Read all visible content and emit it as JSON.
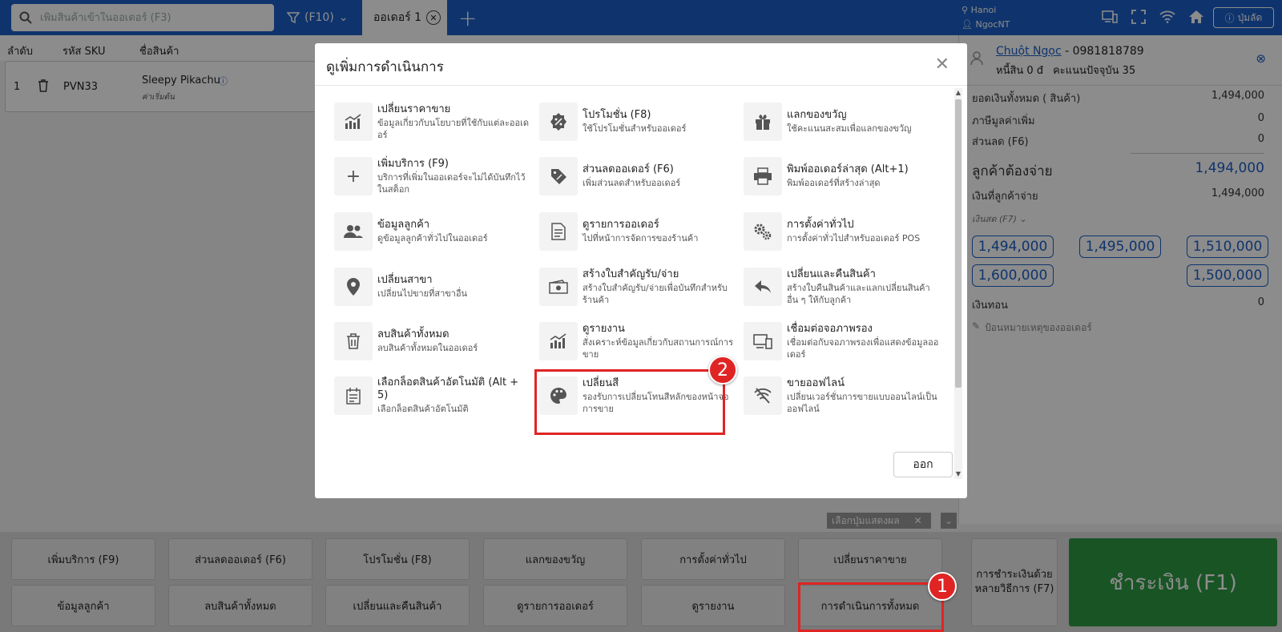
{
  "topbar": {
    "search_placeholder": "เพิ่มสินค้าเข้าในออเดอร์ (F3)",
    "f10_label": "(F10)",
    "active_tab": "ออเดอร์ 1",
    "location": "Hanoi",
    "user": "NgocNT",
    "shortcut_button": "ปุ่มลัด"
  },
  "table": {
    "headers": [
      "ลำดับ",
      "รหัส SKU",
      "ชื่อสินค้า"
    ],
    "row": {
      "index": "1",
      "sku": "PVN33",
      "name": "Sleepy Pikachu",
      "note": "ค่าเริ่มต้น"
    }
  },
  "customer": {
    "name": "Chuột Ngọc",
    "phone": " - 0981818789",
    "debt": "หนี้สิน 0 đ",
    "points": "คะแนนปัจจุบัน 35"
  },
  "summary": {
    "total_label": "ยอดเงินทั้งหมด ( สินค้า)",
    "total_value": "1,494,000",
    "vat_label": "ภาษีมูลค่าเพิ่ม",
    "vat_value": "0",
    "discount_label": "ส่วนลด (F6)",
    "discount_value": "0",
    "due_label": "ลูกค้าต้องจ่าย",
    "due_value": "1,494,000",
    "paid_label": "เงินที่ลูกค้าจ่าย",
    "paid_value": "1,494,000",
    "method_label": "เงินสด (F7)",
    "cash_buttons": [
      "1,494,000",
      "1,495,000",
      "1,510,000",
      "1,600,000",
      "1,500,000"
    ],
    "change_label": "เงินทอน",
    "change_value": "0",
    "note_placeholder": "ป้อนหมายเหตุของออเดอร์"
  },
  "modal": {
    "title": "ดูเพิ่มการดำเนินการ",
    "exit_label": "ออก",
    "actions": [
      {
        "title": "เปลี่ยนราคาขาย",
        "desc": "ข้อมูลเกี่ยวกับนโยบายที่ใช้กับแต่ละออเดอร์",
        "icon": "chart-icon"
      },
      {
        "title": "โปรโมชั่น (F8)",
        "desc": "ใช้โปรโมชั่นสำหรับออเดอร์",
        "icon": "promo-icon"
      },
      {
        "title": "แลกของขวัญ",
        "desc": "ใช้คะแนนสะสมเพื่อแลกของขวัญ",
        "icon": "gift-icon"
      },
      {
        "title": "เพิ่มบริการ (F9)",
        "desc": "บริการที่เพิ่มในออเดอร์จะไม่ได้บันทึกไว้ในสต็อก",
        "icon": "plus-icon"
      },
      {
        "title": "ส่วนลดออเดอร์ (F6)",
        "desc": "เพิ่มส่วนลดสำหรับออเดอร์",
        "icon": "discount-tag-icon"
      },
      {
        "title": "พิมพ์ออเดอร์ล่าสุด (Alt+1)",
        "desc": "พิมพ์ออเดอร์ที่สร้างล่าสุด",
        "icon": "printer-icon"
      },
      {
        "title": "ข้อมูลลูกค้า",
        "desc": "ดูข้อมูลลูกค้าทั่วไปในออเดอร์",
        "icon": "users-icon"
      },
      {
        "title": "ดูรายการออเดอร์",
        "desc": "ไปที่หน้าการจัดการของร้านค้า",
        "icon": "document-icon"
      },
      {
        "title": "การตั้งค่าทั่วไป",
        "desc": "การตั้งค่าทั่วไปสำหรับออเดอร์ POS",
        "icon": "gears-icon"
      },
      {
        "title": "เปลี่ยนสาขา",
        "desc": "เปลี่ยนไปขายที่สาขาอื่น",
        "icon": "location-pin-icon"
      },
      {
        "title": "สร้างใบสำคัญรับ/จ่าย",
        "desc": "สร้างใบสำคัญรับ/จ่ายเพื่อบันทึกสำหรับร้านค้า",
        "icon": "cash-icon"
      },
      {
        "title": "เปลี่ยนและคืนสินค้า",
        "desc": "สร้างใบคืนสินค้าและแลกเปลี่ยนสินค้าอื่น ๆ ให้กับลูกค้า",
        "icon": "reply-icon"
      },
      {
        "title": "ลบสินค้าทั้งหมด",
        "desc": "ลบสินค้าทั้งหมดในออเดอร์",
        "icon": "trash-icon"
      },
      {
        "title": "ดูรายงาน",
        "desc": "สั่งเคราะห์ข้อมูลเกี่ยวกับสถานการณ์การขาย",
        "icon": "report-chart-icon"
      },
      {
        "title": "เชื่อมต่อจอภาพรอง",
        "desc": "เชื่อมต่อกับจอภาพรองเพื่อแสดงข้อมูลออเดอร์",
        "icon": "devices-icon"
      },
      {
        "title": "เลือกล็อตสินค้าอัตโนมัติ (Alt + 5)",
        "desc": "เลือกล็อตสินค้าอัตโนมัติ",
        "icon": "batch-icon"
      },
      {
        "title": "เปลี่ยนสี",
        "desc": "รองรับการเปลี่ยนโทนสีหลักของหน้าจอการขาย",
        "icon": "palette-icon"
      },
      {
        "title": "ขายออฟไลน์",
        "desc": "เปลี่ยนเวอร์ชั่นการขายแบบออนไลน์เป็นออฟไลน์",
        "icon": "wifi-off-icon"
      }
    ]
  },
  "bottom": {
    "chip_label": "เลือกปุ่มแสดงผล",
    "buttons_row1": [
      "เพิ่มบริการ (F9)",
      "ส่วนลดออเดอร์ (F6)",
      "โปรโมชั่น (F8)",
      "แลกของขวัญ",
      "การตั้งค่าทั่วไป",
      "เปลี่ยนราคาขาย"
    ],
    "buttons_row2": [
      "ข้อมูลลูกค้า",
      "ลบสินค้าทั้งหมด",
      "เปลี่ยนและคืนสินค้า",
      "ดูรายการออเดอร์",
      "ดูรายงาน",
      "การดำเนินการทั้งหมด"
    ],
    "pay_multi": "การชำระเงินด้วยหลายวิธีการ (F7)",
    "pay_main": "ชำระเงิน (F1)"
  },
  "annotations": {
    "marker1": "1",
    "marker2": "2"
  },
  "colors": {
    "primary": "#1d5fc6",
    "pay": "#2e9a44",
    "highlight": "#e02424"
  }
}
